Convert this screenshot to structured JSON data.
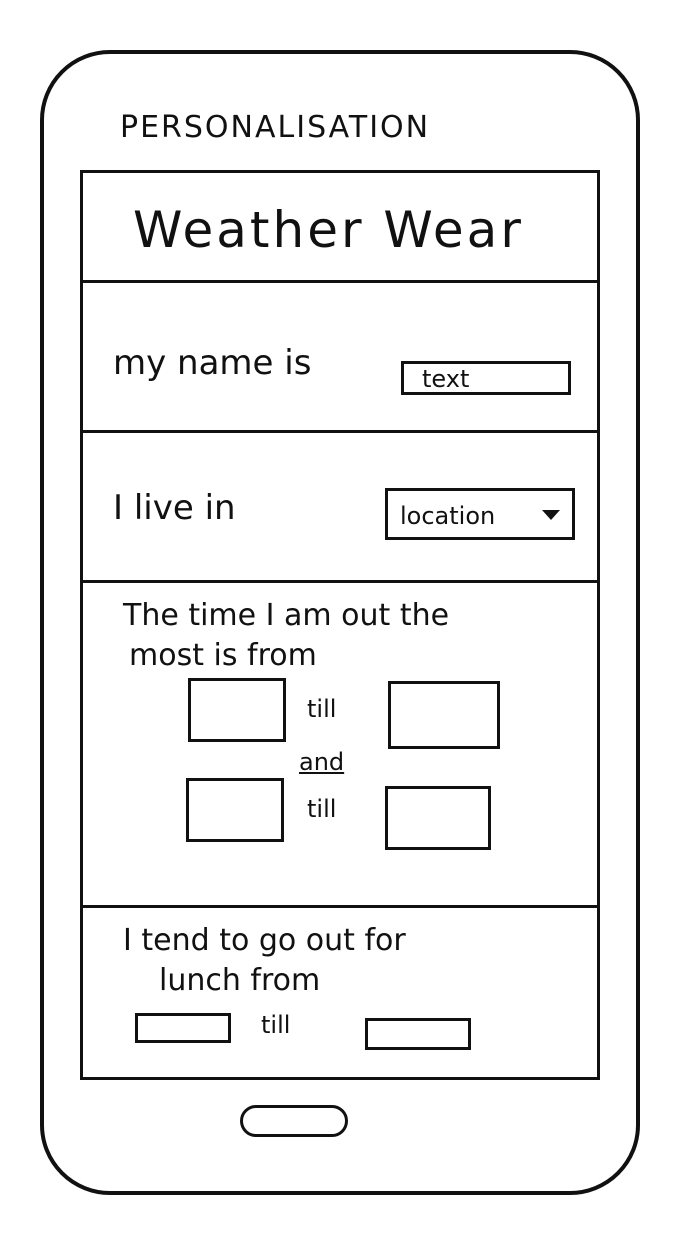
{
  "page": {
    "heading": "PERSONALISATION"
  },
  "app": {
    "title": "Weather Wear"
  },
  "name_section": {
    "label": "my name is",
    "input_placeholder": "text"
  },
  "location_section": {
    "label": "I live in",
    "dropdown_value": "location"
  },
  "time_section": {
    "label_line1": "The time I am out the",
    "label_line2": "most is from",
    "till": "till",
    "and": "and"
  },
  "lunch_section": {
    "label_line1": "I tend to go out for",
    "label_line2": "lunch from",
    "till": "till"
  }
}
